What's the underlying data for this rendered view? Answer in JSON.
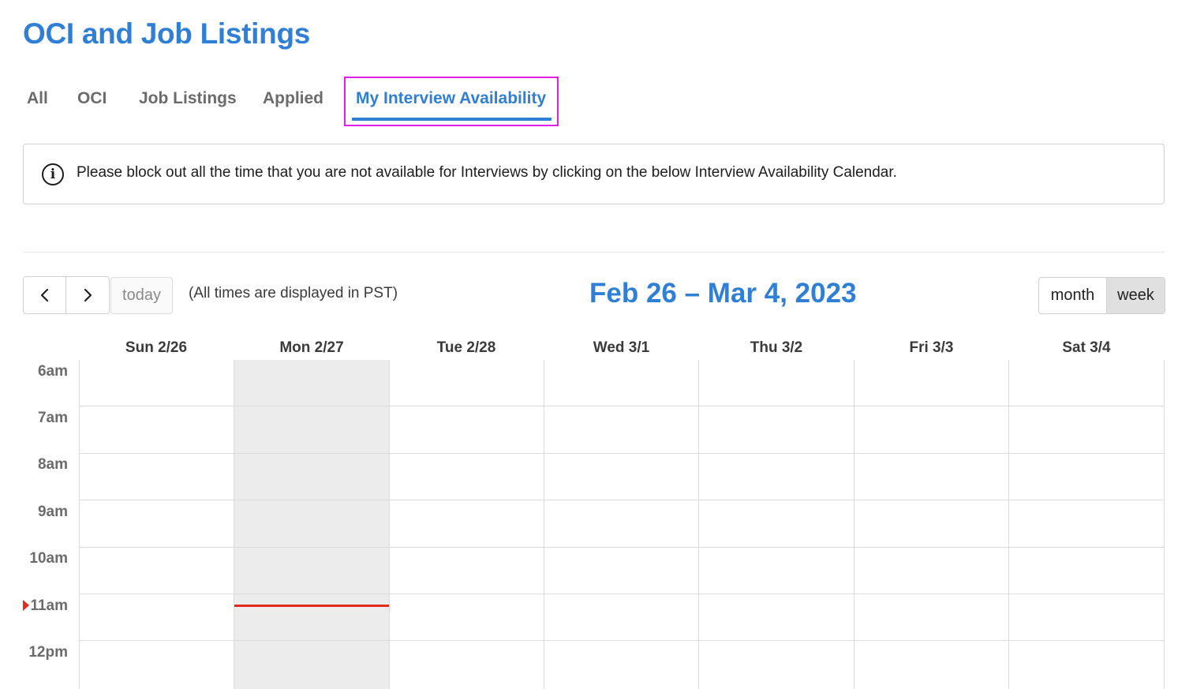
{
  "header": {
    "title": "OCI and Job Listings"
  },
  "tabs": [
    {
      "label": "All",
      "active": false
    },
    {
      "label": "OCI",
      "active": false
    },
    {
      "label": "Job Listings",
      "active": false
    },
    {
      "label": "Applied",
      "active": false
    },
    {
      "label": "My Interview Availability",
      "active": true
    }
  ],
  "info": {
    "icon": "info-icon",
    "message": "Please block out all the time that you are not available for Interviews by clicking on the below Interview Availability Calendar."
  },
  "toolbar": {
    "prev_icon": "chevron-left-icon",
    "next_icon": "chevron-right-icon",
    "today_label": "today",
    "timezone_note": "(All times are displayed in PST)",
    "title": "Feb 26 – Mar 4, 2023",
    "views": [
      {
        "label": "month",
        "active": false
      },
      {
        "label": "week",
        "active": true
      }
    ]
  },
  "calendar": {
    "days": [
      "Sun 2/26",
      "Mon 2/27",
      "Tue 2/28",
      "Wed 3/1",
      "Thu 3/2",
      "Fri 3/3",
      "Sat 3/4"
    ],
    "today": "Mon 2/27",
    "hours": [
      "6am",
      "7am",
      "8am",
      "9am",
      "10am",
      "11am",
      "12pm"
    ],
    "now_indicator_hour": "11am"
  },
  "colors": {
    "accent": "#2f7fd6",
    "tab_highlight": "#e11ee6",
    "now_indicator": "#e22b1a",
    "today_column": "#ececec"
  }
}
